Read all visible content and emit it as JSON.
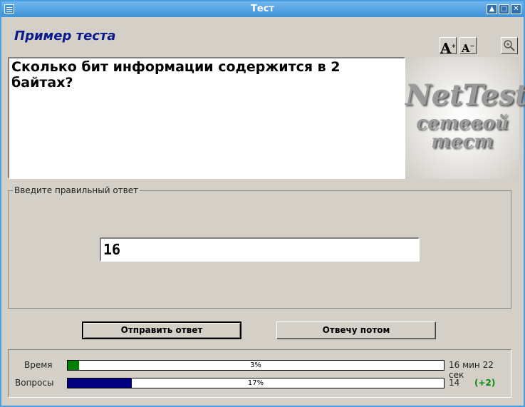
{
  "window": {
    "title": "Тест",
    "buttons": [
      "▲",
      "□",
      "✕"
    ]
  },
  "app": {
    "title": "Пример теста",
    "font_increase_label": "A",
    "font_decrease_label": "A",
    "zoom_icon": "zoom-icon"
  },
  "question": {
    "text": "Сколько бит информации содержится в 2 байтах?"
  },
  "logo": {
    "line1": "NetTest",
    "line2": "сетевой",
    "line3": "тест"
  },
  "answer": {
    "legend": "Введите правильный ответ",
    "value": "16"
  },
  "buttons": {
    "submit": "Отправить ответ",
    "later": "Отвечу потом"
  },
  "status": {
    "time_label": "Время",
    "time_percent": "3%",
    "time_progress": 0.03,
    "time_remaining": "16 мин 22 сек",
    "time_color": "#008000",
    "questions_label": "Вопросы",
    "questions_percent": "17%",
    "questions_progress": 0.17,
    "questions_remaining": "14",
    "questions_bonus": "(+2)",
    "questions_color": "#000080"
  }
}
